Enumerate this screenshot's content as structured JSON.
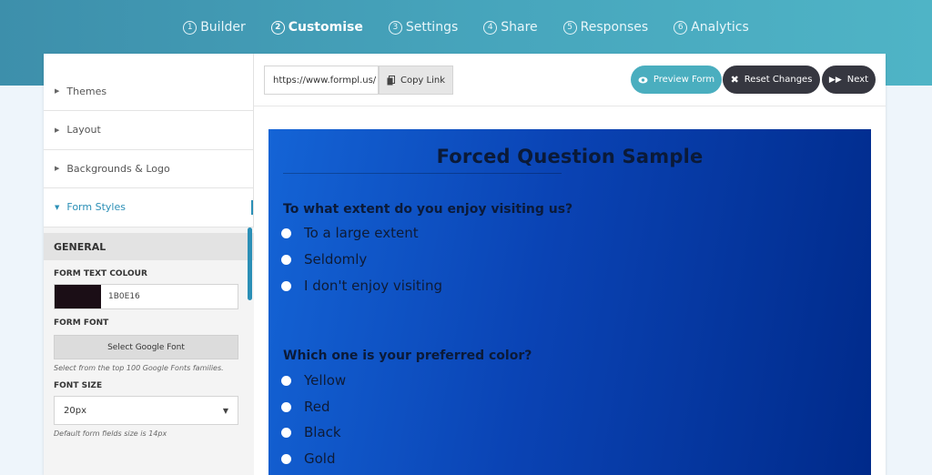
{
  "steps": [
    {
      "num": "1",
      "label": "Builder"
    },
    {
      "num": "2",
      "label": "Customise"
    },
    {
      "num": "3",
      "label": "Settings"
    },
    {
      "num": "4",
      "label": "Share"
    },
    {
      "num": "5",
      "label": "Responses"
    },
    {
      "num": "6",
      "label": "Analytics"
    }
  ],
  "sidebar": {
    "items": [
      {
        "label": "Themes"
      },
      {
        "label": "Layout"
      },
      {
        "label": "Backgrounds & Logo"
      },
      {
        "label": "Form Styles"
      }
    ],
    "general": {
      "heading": "GENERAL",
      "text_colour_label": "FORM TEXT COLOUR",
      "text_colour_value": "1B0E16",
      "text_colour_swatch": "#1b0e16",
      "font_label": "FORM FONT",
      "font_button": "Select Google Font",
      "font_hint": "Select from the top 100 Google Fonts families.",
      "size_label": "FONT SIZE",
      "size_value": "20px",
      "size_hint": "Default form fields size is 14px"
    }
  },
  "toolbar": {
    "url": "https://www.formpl.us/",
    "copy_label": "Copy Link",
    "preview_label": "Preview Form",
    "reset_label": "Reset Changes",
    "next_label": "Next"
  },
  "form": {
    "title": "Forced Question Sample",
    "questions": [
      {
        "text": "To what extent do you enjoy visiting us?",
        "options": [
          "To a large extent",
          "Seldomly",
          "I don't enjoy visiting"
        ]
      },
      {
        "text": "Which one is your preferred color?",
        "options": [
          "Yellow",
          "Red",
          "Black",
          "Gold"
        ]
      }
    ]
  },
  "colors": {
    "accent": "#2b8fb6",
    "header": "#47a6bd",
    "dark_button": "#363740"
  }
}
